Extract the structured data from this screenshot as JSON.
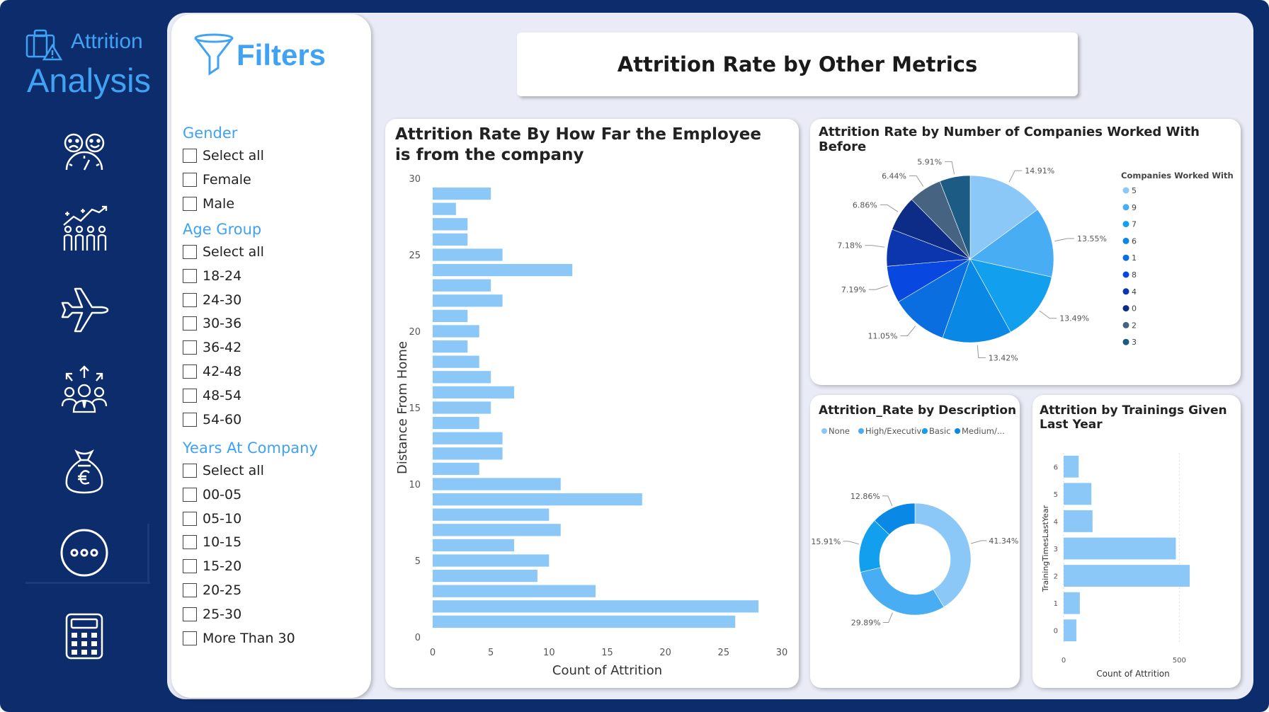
{
  "app": {
    "logo_line1": "Attrition",
    "logo_line2": "Analysis"
  },
  "nav": [
    {
      "icon": "satisfaction-meter-icon"
    },
    {
      "icon": "people-growth-icon"
    },
    {
      "icon": "airplane-icon"
    },
    {
      "icon": "team-manager-icon"
    },
    {
      "icon": "money-bag-euro-icon"
    },
    {
      "icon": "more-options-icon"
    },
    {
      "icon": "calculator-icon"
    }
  ],
  "filters": {
    "title": "Filters",
    "gender": {
      "label": "Gender",
      "options": [
        "Select all",
        "Female",
        "Male"
      ]
    },
    "age_group": {
      "label": "Age Group",
      "options": [
        "Select all",
        "18-24",
        "24-30",
        "30-36",
        "36-42",
        "42-48",
        "48-54",
        "54-60"
      ]
    },
    "years_at_company": {
      "label": "Years At Company",
      "options": [
        "Select all",
        "00-05",
        "05-10",
        "10-15",
        "15-20",
        "20-25",
        "25-30",
        "More Than 30"
      ]
    }
  },
  "page_title": "Attrition Rate by Other Metrics",
  "colors": {
    "navy": "#0d2c6c",
    "accent": "#3fa2f3",
    "bar": "#8bc8f8",
    "canvas": "#e9ebf6"
  },
  "chart_data": [
    {
      "type": "bar",
      "orientation": "horizontal",
      "title": "Attrition Rate By How Far the Employee is from the company",
      "xlabel": "Count of Attrition",
      "ylabel": "Distance From Home",
      "xlim": [
        0,
        30
      ],
      "ylim": [
        0,
        30
      ],
      "x_ticks": [
        0,
        5,
        10,
        15,
        20,
        25,
        30
      ],
      "y_ticks": [
        0,
        5,
        10,
        15,
        20,
        25,
        30
      ],
      "y": [
        1,
        2,
        3,
        4,
        5,
        6,
        7,
        8,
        9,
        10,
        11,
        12,
        13,
        14,
        15,
        16,
        17,
        18,
        19,
        20,
        21,
        22,
        23,
        24,
        25,
        26,
        27,
        28,
        29
      ],
      "values": [
        26,
        28,
        14,
        9,
        10,
        7,
        11,
        10,
        18,
        11,
        4,
        6,
        6,
        4,
        5,
        7,
        5,
        4,
        3,
        4,
        3,
        6,
        5,
        12,
        6,
        3,
        3,
        2,
        5
      ]
    },
    {
      "type": "pie",
      "title": "Attrition Rate by Number of Companies Worked With Before",
      "legend_title": "Companies Worked With",
      "legend_position": "right",
      "labels": [
        "5",
        "9",
        "7",
        "6",
        "1",
        "8",
        "4",
        "0",
        "2",
        "3"
      ],
      "values": [
        14.91,
        13.55,
        13.49,
        13.42,
        11.05,
        7.19,
        7.18,
        6.86,
        6.44,
        5.91
      ],
      "value_labels": [
        "14.91%",
        "13.55%",
        "13.49%",
        "13.42%",
        "11.05%",
        "7.19%",
        "7.18%",
        "6.86%",
        "6.44%",
        "5.91%"
      ],
      "colors": [
        "#8bc8f8",
        "#48adf3",
        "#12a0ee",
        "#0a88e6",
        "#0a6de0",
        "#0848e0",
        "#0b36ae",
        "#0d2c88",
        "#476382",
        "#1c5b84"
      ]
    },
    {
      "type": "donut",
      "title": "Attrition_Rate by Description",
      "legend_position": "top",
      "labels": [
        "None",
        "High/Executive",
        "Basic",
        "Medium/..."
      ],
      "values": [
        41.34,
        29.89,
        15.91,
        12.86
      ],
      "value_labels": [
        "41.34%",
        "29.89%",
        "15.91%",
        "12.86%"
      ],
      "colors": [
        "#8bc8f8",
        "#48adf3",
        "#12a0ee",
        "#0a88e6"
      ]
    },
    {
      "type": "bar",
      "orientation": "horizontal",
      "title": "Attrition by Trainings Given Last Year",
      "xlabel": "Count of Attrition",
      "ylabel": "TrainingTimesLastYear",
      "xlim": [
        0,
        600
      ],
      "x_ticks": [
        0,
        500
      ],
      "y": [
        0,
        1,
        2,
        3,
        4,
        5,
        6
      ],
      "values": [
        55,
        70,
        545,
        485,
        125,
        120,
        65
      ]
    }
  ]
}
